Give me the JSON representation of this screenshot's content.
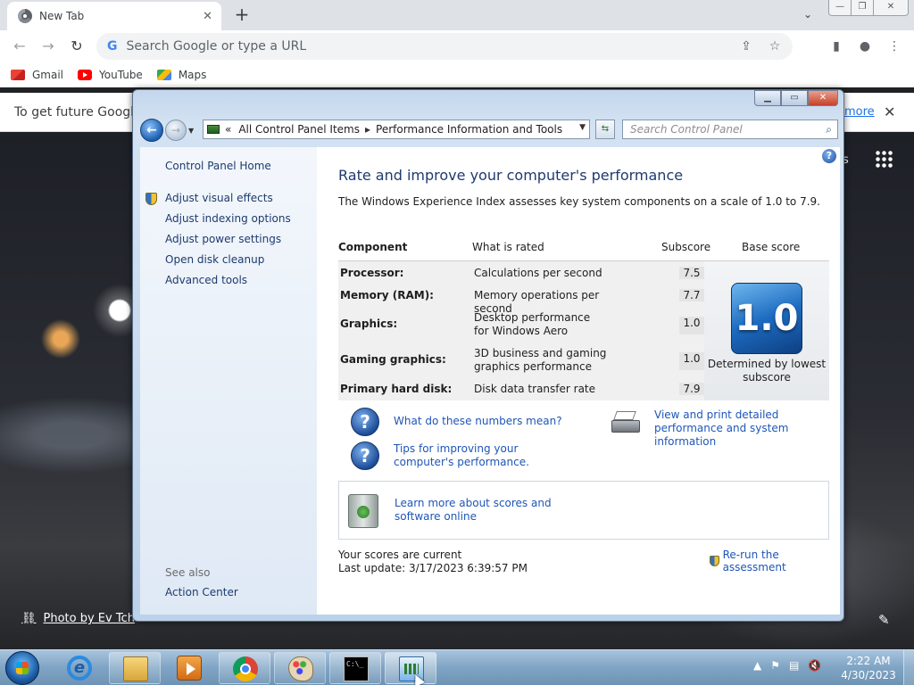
{
  "browser": {
    "tab_title": "New Tab",
    "tab_close": "✕",
    "new_tab": "+",
    "tab_search": "⌄",
    "min": "—",
    "max": "❐",
    "close": "✕",
    "back": "←",
    "forward": "→",
    "reload": "↻",
    "omnibox_placeholder": "Search Google or type a URL",
    "google_g": "G",
    "share_icon": "⇪",
    "star_icon": "☆",
    "sidepanel_icon": "▮",
    "profile_icon": "●",
    "menu_icon": "⋮",
    "bookmarks": [
      {
        "label": "Gmail"
      },
      {
        "label": "YouTube"
      },
      {
        "label": "Maps"
      }
    ],
    "infobar_text": "To get future Google C",
    "infobar_link": "more",
    "infobar_close": "✕",
    "photo_credit": "Photo by Ev Tch",
    "link_icon": "⛓",
    "edit_icon": "✎",
    "signin_stub": "s"
  },
  "control_panel": {
    "caption": {
      "min": "▁",
      "max": "▭",
      "close": "✕"
    },
    "back": "←",
    "forward": "→",
    "nav_drop": "▼",
    "address": {
      "prefix": "«",
      "crumb1": "All Control Panel Items",
      "sep": "▸",
      "crumb2": "Performance Information and Tools",
      "drop": "▼"
    },
    "refresh": "⇆",
    "search_placeholder": "Search Control Panel",
    "search_icon": "⌕",
    "sidebar": {
      "home": "Control Panel Home",
      "links": [
        "Adjust visual effects",
        "Adjust indexing options",
        "Adjust power settings",
        "Open disk cleanup",
        "Advanced tools"
      ],
      "see_also": "See also",
      "action_center": "Action Center"
    },
    "help": "?",
    "title": "Rate and improve your computer's performance",
    "intro": "The Windows Experience Index assesses key system components on a scale of 1.0 to 7.9.",
    "table": {
      "headers": {
        "component": "Component",
        "rated": "What is rated",
        "subscore": "Subscore",
        "base": "Base score"
      },
      "rows": [
        {
          "component": "Processor:",
          "rated": "Calculations per second",
          "subscore": "7.5"
        },
        {
          "component": "Memory (RAM):",
          "rated": "Memory operations per second",
          "subscore": "7.7"
        },
        {
          "component": "Graphics:",
          "rated": "Desktop performance for Windows Aero",
          "subscore": "1.0"
        },
        {
          "component": "Gaming graphics:",
          "rated": "3D business and gaming graphics performance",
          "subscore": "1.0"
        },
        {
          "component": "Primary hard disk:",
          "rated": "Disk data transfer rate",
          "subscore": "7.9"
        }
      ],
      "base_score": "1.0",
      "base_note": "Determined by lowest subscore"
    },
    "links": {
      "q_mark": "?",
      "numbers": "What do these numbers mean?",
      "tips": "Tips for improving your computer's performance.",
      "print": "View and print detailed performance and system information",
      "learn": "Learn more about scores and software online"
    },
    "status": {
      "current": "Your scores are current",
      "last_update": "Last update: 3/17/2023 6:39:57 PM"
    },
    "rerun": "Re-run the assessment"
  },
  "taskbar": {
    "ie": "e",
    "cmd_glyph": "C:\\_",
    "tray_arrow": "▲",
    "tray_flag": "⚑",
    "tray_network": "▤",
    "tray_volume": "🔇",
    "time": "2:22 AM",
    "date": "4/30/2023"
  }
}
